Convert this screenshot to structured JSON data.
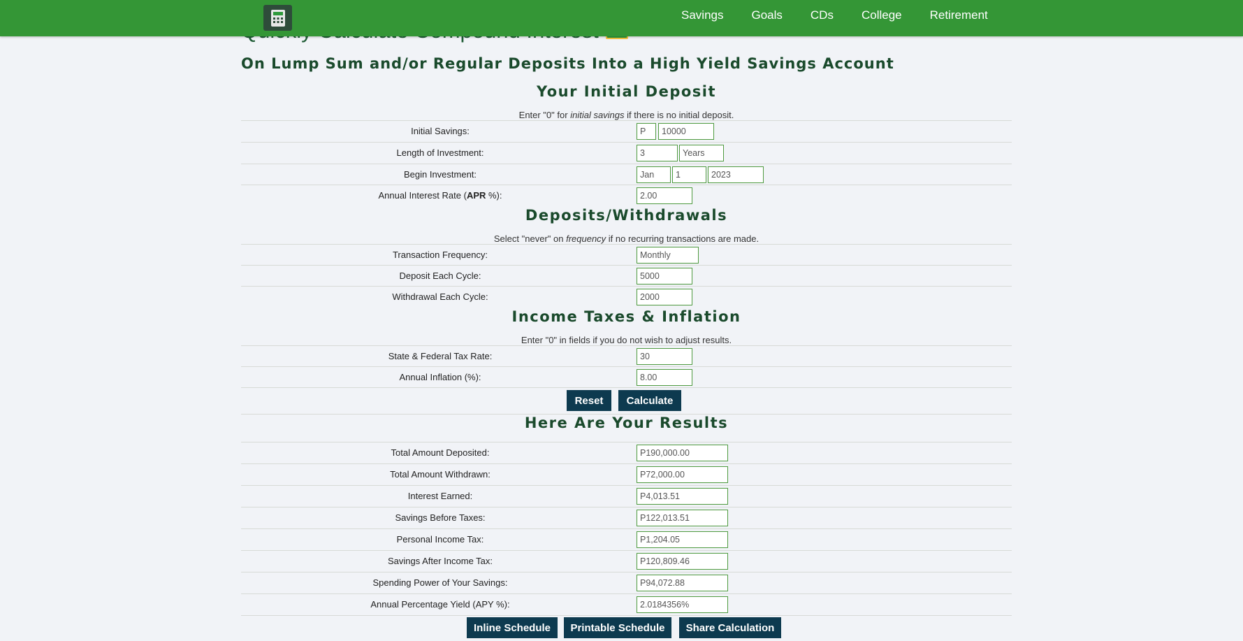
{
  "nav": {
    "items": [
      "Savings",
      "Goals",
      "CDs",
      "College",
      "Retirement"
    ]
  },
  "page": {
    "title": "Quickly Calculate Compound Interest",
    "subtitle": "On Lump Sum and/or Regular Deposits Into a High Yield Savings Account"
  },
  "initial_deposit": {
    "heading": "Your Initial Deposit",
    "note_pre": "Enter \"0\" for ",
    "note_em": "initial savings",
    "note_post": " if there is no initial deposit.",
    "initial_savings_label": "Initial Savings:",
    "currency_symbol": "P",
    "initial_savings_value": "10000",
    "length_label": "Length of Investment:",
    "length_value": "3",
    "length_unit": "Years",
    "begin_label": "Begin Investment:",
    "begin_month": "Jan",
    "begin_day": "1",
    "begin_year": "2023",
    "rate_label_pre": "Annual Interest Rate (",
    "rate_label_bold": "APR",
    "rate_label_post": " %):",
    "rate_value": "2.00"
  },
  "deposits": {
    "heading": "Deposits/Withdrawals",
    "note_pre": "Select \"never\" on ",
    "note_em": "frequency",
    "note_post": " if no recurring transactions are made.",
    "frequency_label": "Transaction Frequency:",
    "frequency_value": "Monthly",
    "deposit_label": "Deposit Each Cycle:",
    "deposit_value": "5000",
    "withdrawal_label": "Withdrawal Each Cycle:",
    "withdrawal_value": "2000"
  },
  "taxes": {
    "heading": "Income Taxes & Inflation",
    "note": "Enter \"0\" in fields if you do not wish to adjust results.",
    "tax_label": "State & Federal Tax Rate:",
    "tax_value": "30",
    "inflation_label": "Annual Inflation (%):",
    "inflation_value": "8.00"
  },
  "buttons": {
    "reset": "Reset",
    "calculate": "Calculate",
    "inline_schedule": "Inline Schedule",
    "printable_schedule": "Printable Schedule",
    "share_calculation": "Share Calculation"
  },
  "results": {
    "heading": "Here Are Your Results",
    "rows": [
      {
        "label": "Total Amount Deposited:",
        "value": "P190,000.00"
      },
      {
        "label": "Total Amount Withdrawn:",
        "value": "P72,000.00"
      },
      {
        "label": "Interest Earned:",
        "value": "P4,013.51"
      },
      {
        "label": "Savings Before Taxes:",
        "value": "P122,013.51"
      },
      {
        "label": "Personal Income Tax:",
        "value": "P1,204.05"
      },
      {
        "label": "Savings After Income Tax:",
        "value": "P120,809.46"
      },
      {
        "label": "Spending Power of Your Savings:",
        "value": "P94,072.88"
      },
      {
        "label": "Annual Percentage Yield (APY %):",
        "value": "2.0184356%"
      }
    ]
  }
}
